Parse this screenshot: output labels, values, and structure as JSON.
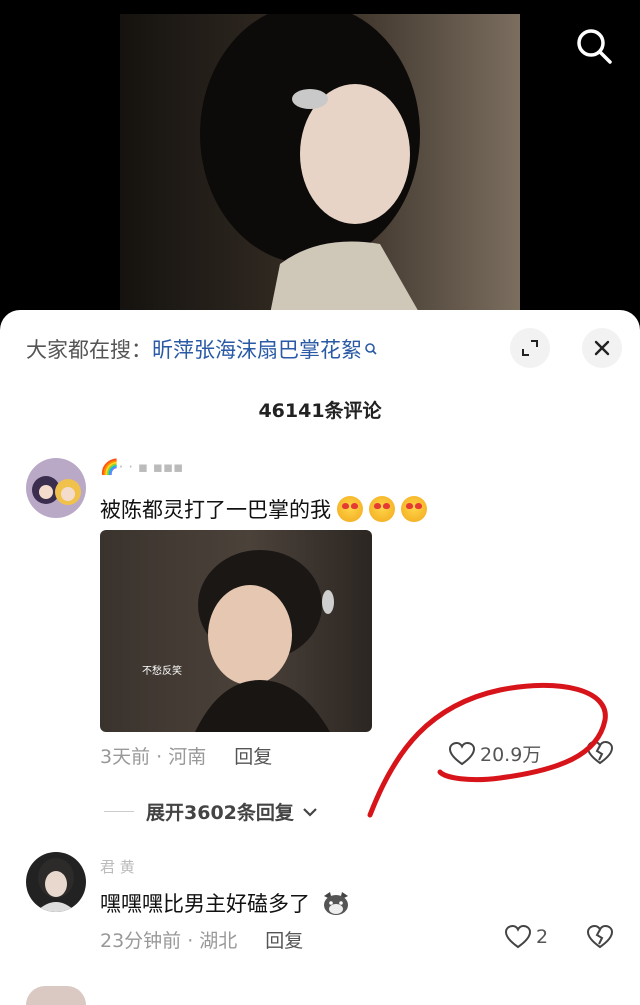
{
  "video": {
    "subtitle": ""
  },
  "hot_search": {
    "prefix": "大家都在搜：",
    "term": "昕萍张海沫扇巴掌花絮"
  },
  "comments_count": "46141条评论",
  "comments": [
    {
      "username": "🌈· ·  ▪ ▪▪▪",
      "text": "被陈都灵打了一巴掌的我",
      "attachment_caption": "不愁反笑",
      "time_location": "3天前 · 河南",
      "reply_label": "回复",
      "likes": "20.9万",
      "expand_replies": "展开3602条回复"
    },
    {
      "username": "君 黄",
      "text": "嘿嘿嘿比男主好磕多了",
      "time_location": "23分钟前 · 湖北",
      "reply_label": "回复",
      "likes": "2"
    }
  ],
  "icons": {
    "search": "search-icon",
    "expand": "expand-icon",
    "close": "close-icon",
    "like": "heart-icon",
    "dislike": "broken-heart-icon"
  },
  "colors": {
    "hot_term": "#2a5aa5",
    "annotation": "#d7141a"
  }
}
